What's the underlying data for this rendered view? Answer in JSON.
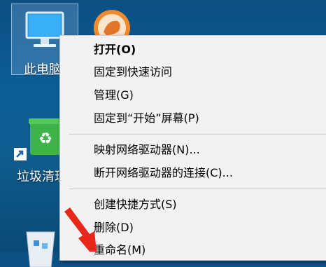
{
  "desktop": {
    "this_pc_label": "此电脑",
    "recycle_bin_label": "垃圾清理"
  },
  "context_menu": {
    "items": [
      {
        "label": "打开(O)",
        "bold": true
      },
      {
        "label": "固定到快速访问"
      },
      {
        "label": "管理(G)"
      },
      {
        "label": "固定到“开始”屏幕(P)"
      },
      {
        "label": "映射网络驱动器(N)..."
      },
      {
        "label": "断开网络驱动器的连接(C)..."
      },
      {
        "label": "创建快捷方式(S)"
      },
      {
        "label": "删除(D)"
      },
      {
        "label": "重命名(M)"
      }
    ]
  },
  "colors": {
    "desktop_bg": "#0b5d96",
    "menu_bg": "#f2f2f2",
    "annotation_arrow": "#e8261a"
  }
}
